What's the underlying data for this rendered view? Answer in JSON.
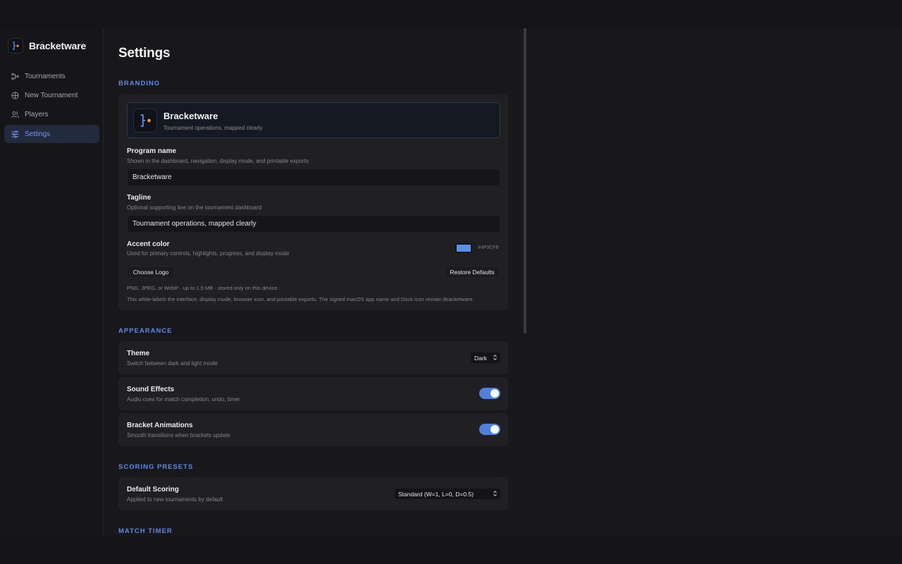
{
  "app": {
    "brand_name": "Bracketware"
  },
  "sidebar": {
    "items": [
      {
        "label": "Tournaments",
        "icon": "bracket-icon",
        "active": false
      },
      {
        "label": "New Tournament",
        "icon": "globe-icon",
        "active": false
      },
      {
        "label": "Players",
        "icon": "users-icon",
        "active": false
      },
      {
        "label": "Settings",
        "icon": "sliders-icon",
        "active": true
      }
    ]
  },
  "page": {
    "title": "Settings"
  },
  "branding": {
    "section_title": "BRANDING",
    "preview_name": "Bracketware",
    "preview_tagline": "Tournament operations, mapped clearly",
    "program_name_label": "Program name",
    "program_name_help": "Shown in the dashboard, navigation, display mode, and printable exports",
    "program_name_value": "Bracketware",
    "tagline_label": "Tagline",
    "tagline_help": "Optional supporting line on the tournament dashboard",
    "tagline_value": "Tournament operations, mapped clearly",
    "accent_label": "Accent color",
    "accent_help": "Used for primary controls, highlights, progress, and display mode",
    "accent_hex": "#4F9CF8",
    "choose_logo_label": "Choose Logo",
    "restore_defaults_label": "Restore Defaults",
    "logo_note": "PNG, JPEG, or WebP · up to 1.5 MB · stored only on this device.",
    "whitelabel_note": "This white-labels the interface, display mode, browser icon, and printable exports. The signed macOS app name and Dock icon remain Bracketware."
  },
  "appearance": {
    "section_title": "APPEARANCE",
    "theme_label": "Theme",
    "theme_help": "Switch between dark and light mode",
    "theme_value": "Dark",
    "sound_label": "Sound Effects",
    "sound_help": "Audio cues for match completion, undo, timer",
    "sound_on": true,
    "anim_label": "Bracket Animations",
    "anim_help": "Smooth transitions when brackets update",
    "anim_on": true
  },
  "scoring": {
    "section_title": "SCORING PRESETS",
    "default_label": "Default Scoring",
    "default_help": "Applied to new tournaments by default",
    "default_value": "Standard (W=1, L=0, D=0.5)"
  },
  "timer": {
    "section_title": "MATCH TIMER"
  },
  "colors": {
    "accent_swatch": "#5a8ff0",
    "accent_ui": "#5b8ae6",
    "logo_orange": "#f0a11c"
  }
}
